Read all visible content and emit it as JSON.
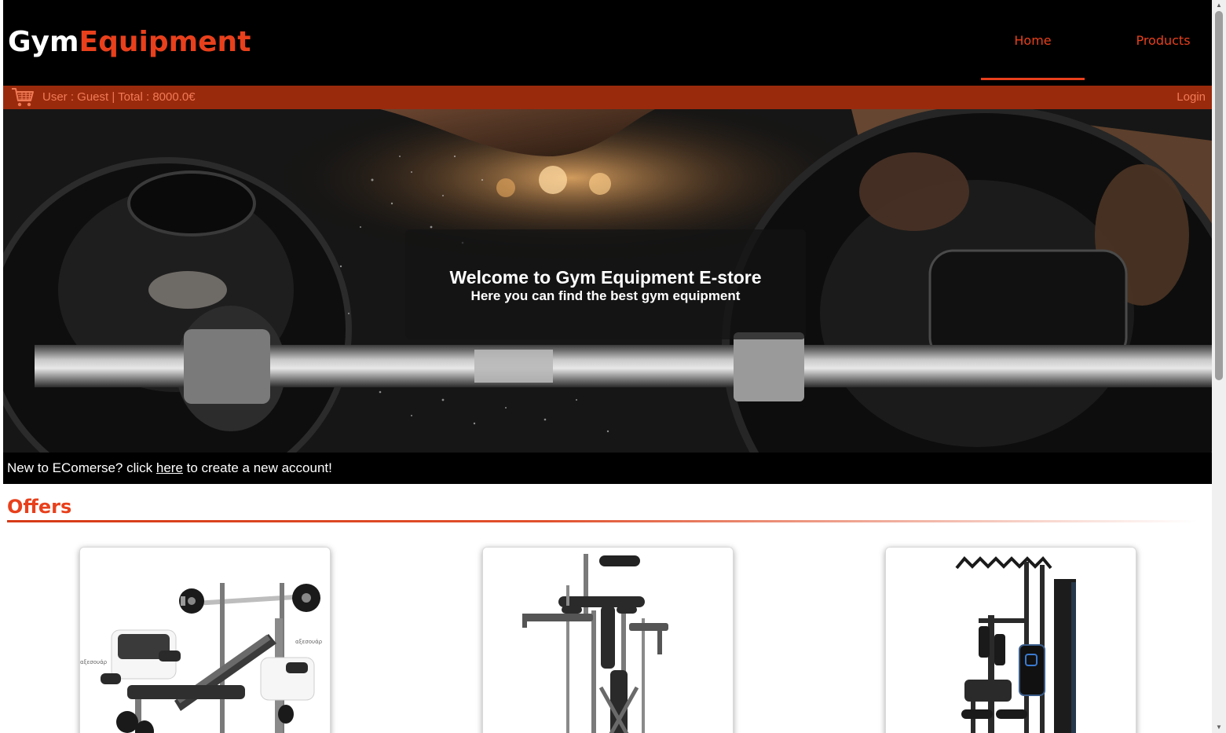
{
  "header": {
    "logo_part1": "Gym",
    "logo_part2": "Equipment",
    "nav": [
      {
        "label": "Home",
        "active": true
      },
      {
        "label": "Products",
        "active": false
      }
    ]
  },
  "userbar": {
    "cart_icon": "shopping-cart-icon",
    "user_text": "User : Guest | Total : 8000.0€",
    "login_label": "Login"
  },
  "hero": {
    "title": "Welcome to Gym Equipment E-store",
    "subtitle": "Here you can find the best gym equipment"
  },
  "signup": {
    "prefix": "New to EComerse? click ",
    "link_label": "here",
    "suffix": " to create a new account!"
  },
  "offers": {
    "title": "Offers",
    "products": [
      {
        "image": "weight-bench-with-barbell-image",
        "labels": [
          "αξεσουάρ",
          "αξεσουάρ"
        ]
      },
      {
        "image": "power-tower-station-image"
      },
      {
        "image": "home-gym-machine-image"
      }
    ]
  },
  "colors": {
    "accent": "#e8401c",
    "userbar_bg": "#9a2a0c",
    "header_bg": "#000000"
  }
}
